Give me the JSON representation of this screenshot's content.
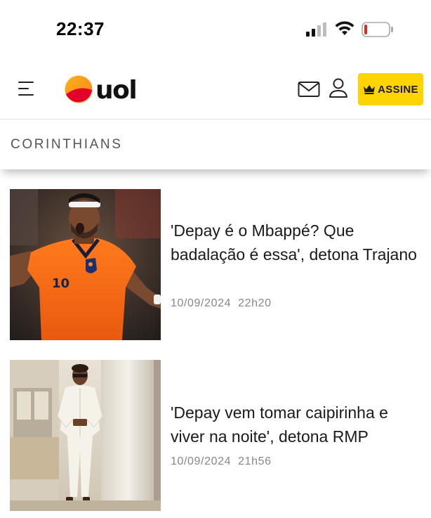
{
  "status_bar": {
    "time": "22:37",
    "icons": [
      "signal-icon",
      "wifi-icon",
      "battery-icon"
    ]
  },
  "header": {
    "logo_text": "uol",
    "menu_icon": "hamburger-menu-icon",
    "mail_icon": "mail-icon",
    "user_icon": "user-icon",
    "assine_label": "ASSINE",
    "assine_icon": "crown-icon"
  },
  "section": {
    "title": "CORINTHIANS"
  },
  "articles": [
    {
      "headline": "'Depay é o Mbappé? Que badalação é essa', detona Trajano",
      "date": "10/09/2024",
      "time": "22h20",
      "image": "player-orange-jersey-photo"
    },
    {
      "headline": "'Depay vem tomar caipirinha e viver na noite', detona RMP",
      "date": "10/09/2024",
      "time": "21h56",
      "image": "man-white-suit-photo"
    }
  ],
  "colors": {
    "assine_bg": "#ffd400",
    "logo_orange": "#f7941d",
    "logo_red": "#e3002b",
    "meta_gray": "#888888",
    "battery_low": "#e0281c"
  }
}
